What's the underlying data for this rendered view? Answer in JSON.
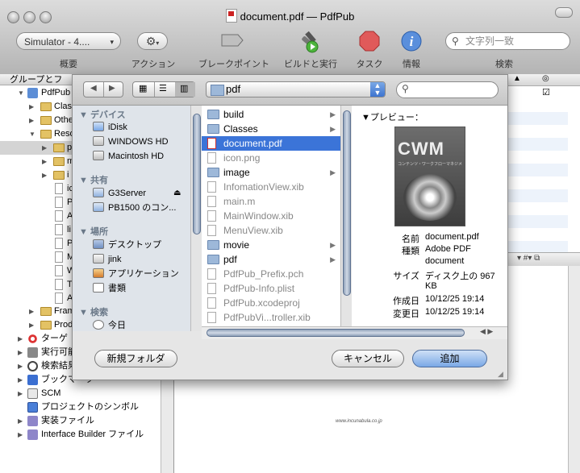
{
  "window": {
    "title": "document.pdf — PdfPub"
  },
  "toolbar": {
    "scheme": "Simulator - 4....",
    "labels": {
      "overview": "概要",
      "action": "アクション",
      "breakpoint": "ブレークポイント",
      "build_run": "ビルドと実行",
      "tasks": "タスク",
      "info": "情報",
      "search": "検索"
    },
    "search_placeholder": "文字列一致"
  },
  "sidebar": {
    "header": "グループとフ",
    "items": [
      {
        "label": "PdfPub"
      },
      {
        "label": "Class"
      },
      {
        "label": "Othe"
      },
      {
        "label": "Reso"
      },
      {
        "label": "p"
      },
      {
        "label": "m"
      },
      {
        "label": "i"
      },
      {
        "label": "ic"
      },
      {
        "label": "P"
      },
      {
        "label": "A"
      },
      {
        "label": "li"
      },
      {
        "label": "P"
      },
      {
        "label": "M"
      },
      {
        "label": "W"
      },
      {
        "label": "T"
      },
      {
        "label": "A"
      },
      {
        "label": "Fram"
      },
      {
        "label": "Prod"
      },
      {
        "label": "ターゲ"
      },
      {
        "label": "実行可能"
      },
      {
        "label": "検索結果"
      },
      {
        "label": "ブックマーク"
      },
      {
        "label": "SCM"
      },
      {
        "label": "プロジェクトのシンボル"
      },
      {
        "label": "実装ファイル"
      },
      {
        "label": "Interface Builder ファイル"
      }
    ]
  },
  "sheet": {
    "location": "pdf",
    "places": {
      "devices_header": "デバイス",
      "devices": [
        "iDisk",
        "WINDOWS HD",
        "Macintosh HD"
      ],
      "shared_header": "共有",
      "shared": [
        "G3Server",
        "PB1500 のコン..."
      ],
      "places_header": "場所",
      "places": [
        "デスクトップ",
        "jink",
        "アプリケーション",
        "書類"
      ],
      "search_header": "検索",
      "search": [
        "今日"
      ]
    },
    "files": [
      {
        "name": "build",
        "kind": "folder"
      },
      {
        "name": "Classes",
        "kind": "folder"
      },
      {
        "name": "document.pdf",
        "kind": "pdf"
      },
      {
        "name": "icon.png",
        "kind": "file"
      },
      {
        "name": "image",
        "kind": "folder"
      },
      {
        "name": "InfomationView.xib",
        "kind": "file"
      },
      {
        "name": "main.m",
        "kind": "file"
      },
      {
        "name": "MainWindow.xib",
        "kind": "file"
      },
      {
        "name": "MenuView.xib",
        "kind": "file"
      },
      {
        "name": "movie",
        "kind": "folder"
      },
      {
        "name": "pdf",
        "kind": "folder"
      },
      {
        "name": "PdfPub_Prefix.pch",
        "kind": "file"
      },
      {
        "name": "PdfPub-Info.plist",
        "kind": "file"
      },
      {
        "name": "PdfPub.xcodeproj",
        "kind": "file"
      },
      {
        "name": "PdfPubVi...troller.xib",
        "kind": "file"
      }
    ],
    "preview": {
      "header": "プレビュー：",
      "cover_title": "CWM",
      "cover_sub": "コンテンツ・ワークフローマネジメント",
      "rows": [
        {
          "label": "名前",
          "value": "document.pdf"
        },
        {
          "label": "種類",
          "value": "Adobe PDF"
        },
        {
          "label": "",
          "value": "document"
        },
        {
          "label": "サイズ",
          "value": "ディスク上の 967"
        },
        {
          "label": "",
          "value": "KB"
        },
        {
          "label": "作成日",
          "value": "10/12/25 19:14"
        },
        {
          "label": "変更日",
          "value": "10/12/25 19:14"
        }
      ]
    },
    "buttons": {
      "new_folder": "新規フォルダ",
      "cancel": "キャンセル",
      "add": "追加"
    }
  },
  "footer_url": "www.incunabula.co.jp"
}
